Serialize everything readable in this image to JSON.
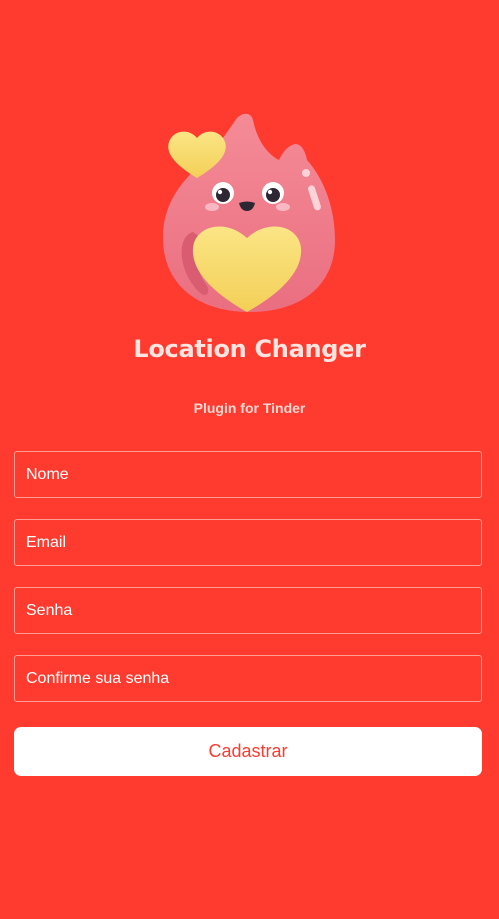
{
  "header": {
    "title": "Location Changer",
    "subtitle": "Plugin for Tinder",
    "logo_icon": "flame-heart-mascot-icon"
  },
  "form": {
    "name_placeholder": "Nome",
    "email_placeholder": "Email",
    "password_placeholder": "Senha",
    "confirm_password_placeholder": "Confirme sua senha",
    "submit_label": "Cadastrar"
  },
  "colors": {
    "background": "#ff3a2e",
    "button_background": "#ffffff",
    "button_text": "#ff3a2e",
    "title_text": "#ffe3df",
    "mascot_body": "#f07f8c",
    "heart": "#f7da68"
  }
}
